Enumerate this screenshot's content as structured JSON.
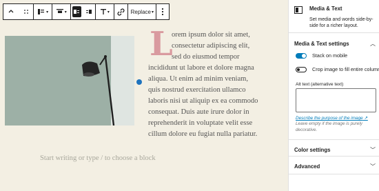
{
  "toolbar": {
    "replace_label": "Replace",
    "items": [
      "transform-icon",
      "drag-handle-icon",
      "align-icon",
      "vertical-align-icon",
      "media-left-icon",
      "media-right-icon",
      "text-style-icon",
      "link-icon",
      "more-options-icon"
    ]
  },
  "content": {
    "dropcap": "L",
    "lines": [
      "orem ipsum dolor sit amet,",
      "consectetur adipiscing elit,",
      "sed do eiusmod tempor",
      "incididunt ut labore et dolore magna",
      "aliqua. Ut enim ad minim veniam,",
      "quis nostrud exercitation ullamco",
      "laboris nisi ut aliquip ex ea commodo",
      "consequat. Duis aute irure dolor in",
      "reprehenderit in voluptate velit esse",
      "cillum dolore eu fugiat nulla pariatur."
    ],
    "placeholder": "Start writing or type / to choose a block"
  },
  "sidebar": {
    "block_title": "Media & Text",
    "block_description": "Set media and words side-by-side for a richer layout.",
    "settings_title": "Media & Text settings",
    "stack_on_mobile": {
      "label": "Stack on mobile",
      "on": true
    },
    "crop_image": {
      "label": "Crop image to fill entire column",
      "on": false
    },
    "alt_label": "Alt text (alternative text)",
    "alt_link": "Describe the purpose of the image",
    "alt_help": "Leave empty if the image is purely decorative.",
    "color_settings": "Color settings",
    "advanced": "Advanced"
  },
  "colors": {
    "accent": "#007cba",
    "dropcap": "#d99a9f",
    "canvas_bg": "#f3efe3"
  }
}
